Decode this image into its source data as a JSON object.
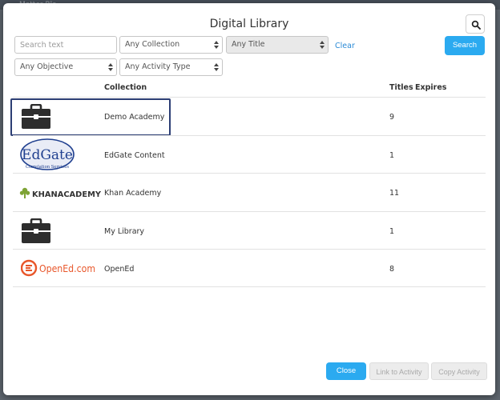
{
  "background": {
    "ghost_text": "Matter Bla"
  },
  "modal": {
    "title": "Digital Library",
    "search_icon": "search-icon"
  },
  "filters": {
    "search_placeholder": "Search text",
    "collection": "Any Collection",
    "title": "Any Title",
    "objective": "Any Objective",
    "activity_type": "Any Activity Type",
    "clear_label": "Clear",
    "search_label": "Search"
  },
  "table": {
    "headers": {
      "collection": "Collection",
      "titles": "Titles",
      "expires": "Expires"
    },
    "rows": [
      {
        "logo": "briefcase-icon",
        "name": "Demo Academy",
        "titles": "9",
        "selected": true
      },
      {
        "logo": "edgate-logo",
        "logo_text": "EdGate",
        "logo_subtext": "Correlation Services",
        "name": "EdGate Content",
        "titles": "1"
      },
      {
        "logo": "khan-academy-logo",
        "logo_text": "KHANACADEMY",
        "name": "Khan Academy",
        "titles": "11"
      },
      {
        "logo": "briefcase-icon",
        "name": "My Library",
        "titles": "1"
      },
      {
        "logo": "opened-logo",
        "logo_text": "OpenEd.com",
        "name": "OpenEd",
        "titles": "8"
      }
    ]
  },
  "footer": {
    "close_label": "Close",
    "link_label": "Link to Activity",
    "copy_label": "Copy Activity"
  },
  "colors": {
    "primary": "#2baaf0",
    "selection_border": "#2c3e74",
    "edgate_blue": "#1f3f8f",
    "khan_green": "#7ea335",
    "opened_orange": "#e8562a"
  }
}
